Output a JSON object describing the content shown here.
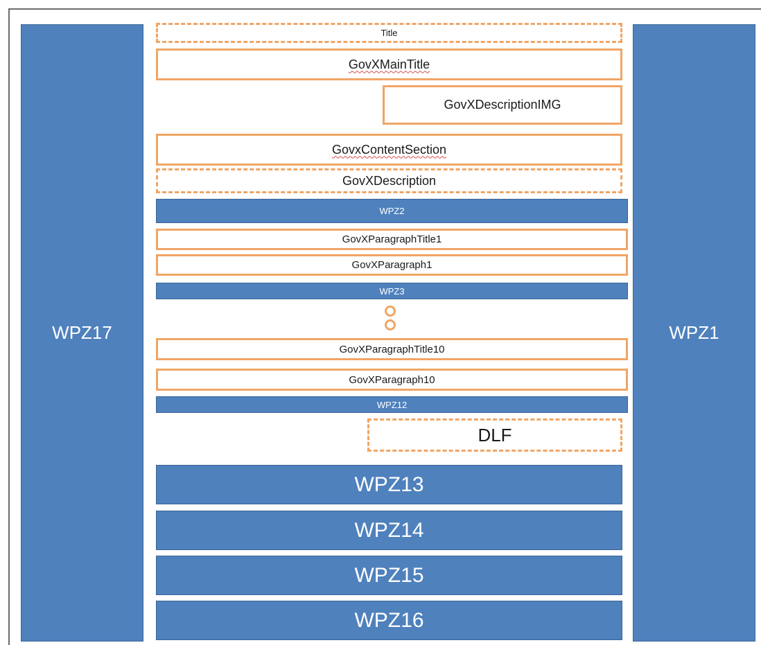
{
  "zones": {
    "left": "WPZ17",
    "right": "WPZ1",
    "wpz2": "WPZ2",
    "wpz3": "WPZ3",
    "wpz12": "WPZ12",
    "wpz13": "WPZ13",
    "wpz14": "WPZ14",
    "wpz15": "WPZ15",
    "wpz16": "WPZ16"
  },
  "fields": {
    "title": "Title",
    "main_title": "GovXMainTitle",
    "description_img": "GovXDescriptionIMG",
    "content_section": "GovxContentSection",
    "description": "GovXDescription",
    "paragraph_title_1": "GovXParagraphTitle1",
    "paragraph_1": "GovXParagraph1",
    "paragraph_title_10": "GovXParagraphTitle10",
    "paragraph_10": "GovXParagraph10",
    "dlf": "DLF"
  },
  "colors": {
    "zone_blue": "#4f81bd",
    "field_orange": "#f0a565"
  }
}
